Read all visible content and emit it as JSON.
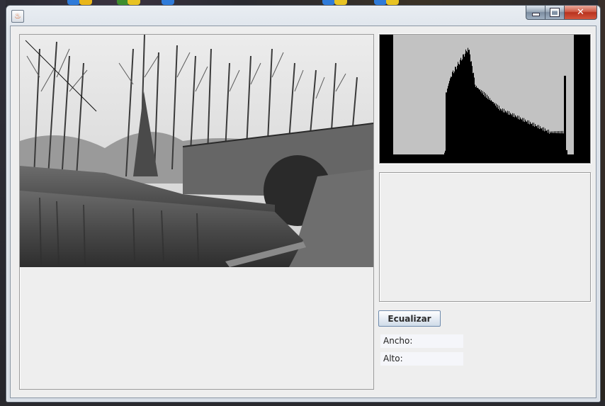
{
  "window": {
    "title": "",
    "controls": {
      "close_symbol": "✕"
    }
  },
  "buttons": {
    "equalize_label": "Ecualizar"
  },
  "info": {
    "width_label": "Ancho:",
    "height_label": "Alto:"
  },
  "icons": {
    "app": "java-icon",
    "minimize": "minimize-icon",
    "maximize": "maximize-icon",
    "close": "close-icon"
  },
  "colors": {
    "histogram_fill": "#000000",
    "histogram_background": "#c2c2c2",
    "client_bg": "#eeeeee"
  },
  "histogram": {
    "bins_start": 64,
    "bins_end": 250,
    "left_margin_bins": 19,
    "right_margin_bins": 23
  }
}
